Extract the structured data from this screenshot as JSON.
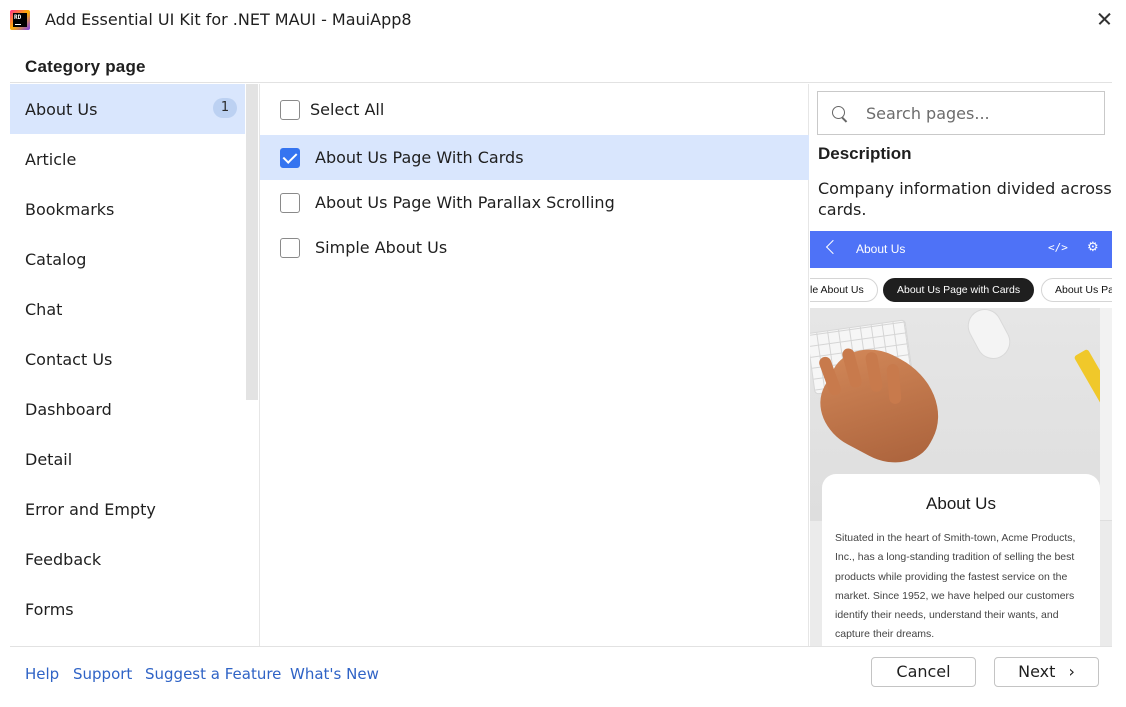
{
  "window": {
    "title": "Add Essential UI Kit for .NET MAUI - MauiApp8",
    "logo_text": "RD"
  },
  "section_title": "Category page",
  "categories": [
    {
      "label": "About Us",
      "count": "1",
      "selected": true
    },
    {
      "label": "Article"
    },
    {
      "label": "Bookmarks"
    },
    {
      "label": "Catalog"
    },
    {
      "label": "Chat"
    },
    {
      "label": "Contact Us"
    },
    {
      "label": "Dashboard"
    },
    {
      "label": "Detail"
    },
    {
      "label": "Error and Empty"
    },
    {
      "label": "Feedback"
    },
    {
      "label": "Forms"
    }
  ],
  "pages": {
    "select_all": "Select All",
    "items": [
      {
        "label": "About Us Page With Cards",
        "checked": true
      },
      {
        "label": "About Us Page With Parallax Scrolling",
        "checked": false
      },
      {
        "label": "Simple About Us",
        "checked": false
      }
    ]
  },
  "search": {
    "placeholder": "Search pages...",
    "value": ""
  },
  "description": {
    "heading": "Description",
    "text": "Company information divided across cards."
  },
  "preview": {
    "header_title": "About Us",
    "code_icon": "</>",
    "chips": [
      "le About Us",
      "About Us Page with Cards",
      "About Us Pa"
    ],
    "card_title": "About Us",
    "card_text": "Situated in the heart of Smith-town, Acme Products, Inc., has a long-standing tradition of selling the best products while providing the fastest service on the market. Since 1952, we have helped our customers identify their needs, understand their wants, and capture their dreams."
  },
  "footer": {
    "links": [
      "Help",
      "Support",
      "Suggest a Feature",
      "What's New"
    ],
    "cancel": "Cancel",
    "next": "Next"
  },
  "colors": {
    "accent": "#3574f0",
    "selection": "#d9e6fd",
    "link": "#2f63c6",
    "preview_header": "#4e72f7"
  }
}
